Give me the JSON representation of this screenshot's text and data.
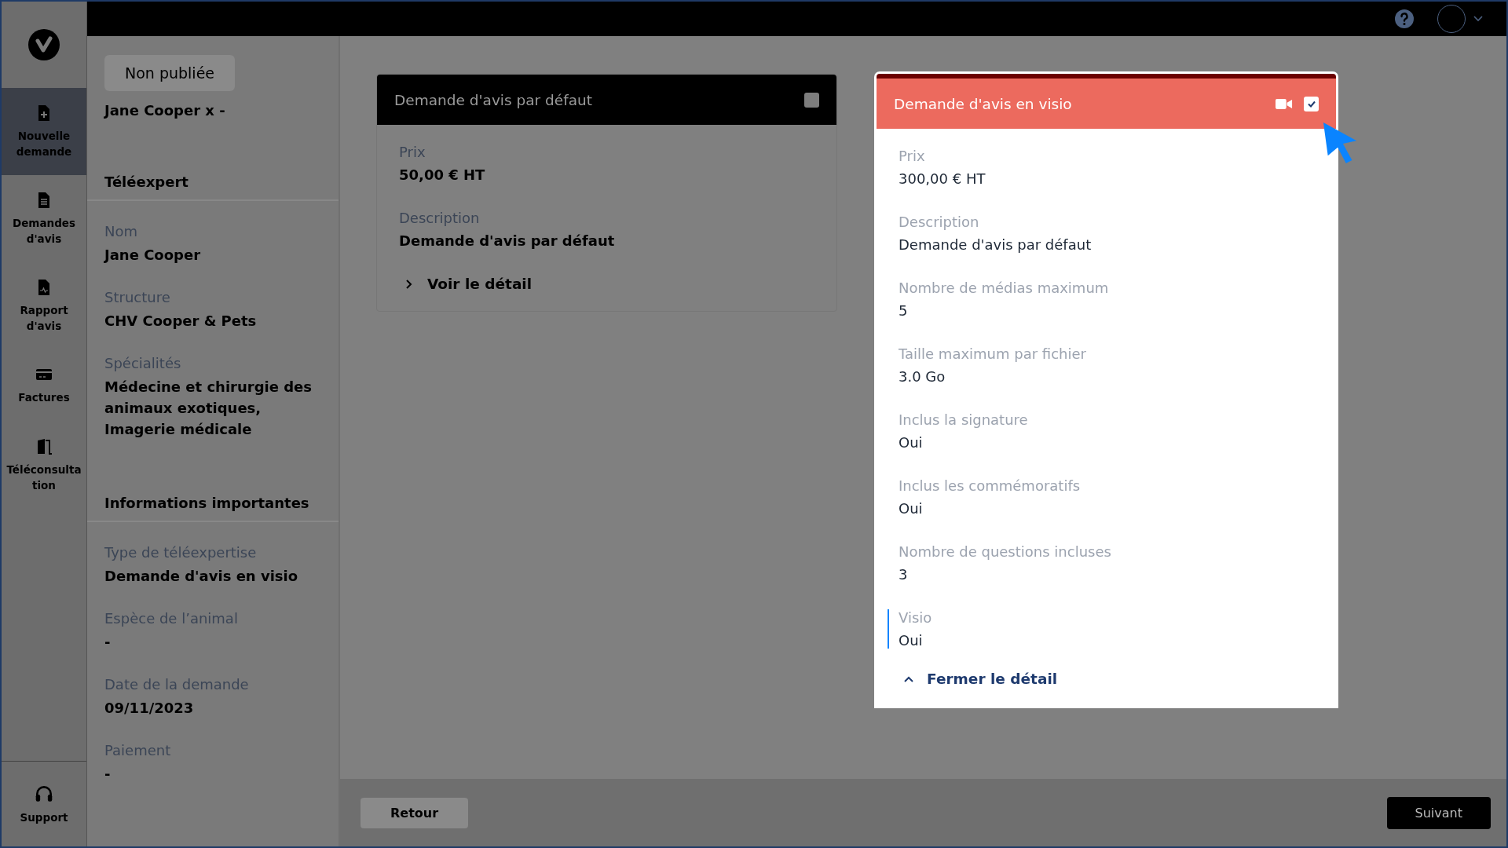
{
  "sidebar": {
    "items": [
      {
        "label": "Nouvelle demande",
        "selected": true
      },
      {
        "label": "Demandes d'avis",
        "selected": false
      },
      {
        "label": "Rapport d'avis",
        "selected": false
      },
      {
        "label": "Factures",
        "selected": false
      },
      {
        "label": "Téléconsultation",
        "selected": false
      }
    ],
    "footer_item": {
      "label": "Support",
      "selected": false
    }
  },
  "summary": {
    "status": "Non publiée",
    "title": "Jane Cooper x -",
    "sections": [
      {
        "title": "Téléexpert",
        "fields": [
          {
            "label": "Nom",
            "value": "Jane Cooper"
          },
          {
            "label": "Structure",
            "value": "CHV Cooper & Pets"
          },
          {
            "label": "Spécialités",
            "value": "Médecine et chirurgie des animaux exotiques, Imagerie médicale"
          }
        ]
      },
      {
        "title": "Informations importantes",
        "fields": [
          {
            "label": "Type de téléexpertise",
            "value": "Demande d'avis en visio"
          },
          {
            "label": "Espèce de l’animal",
            "value": "-"
          },
          {
            "label": "Date de la demande",
            "value": "09/11/2023"
          },
          {
            "label": "Paiement",
            "value": "-"
          }
        ]
      }
    ]
  },
  "offers": [
    {
      "kind": "standard",
      "title": "Demande d'avis par défaut",
      "selected": false,
      "expanded": false,
      "toggle_label": "Voir le détail",
      "fields": [
        {
          "label": "Prix",
          "value": "50,00 € HT",
          "focused": false
        },
        {
          "label": "Description",
          "value": "Demande d'avis par défaut",
          "focused": false
        }
      ]
    },
    {
      "kind": "visio",
      "title": "Demande d'avis en visio",
      "selected": true,
      "expanded": true,
      "toggle_label": "Fermer le détail",
      "fields": [
        {
          "label": "Prix",
          "value": "300,00 € HT",
          "focused": false
        },
        {
          "label": "Description",
          "value": "Demande d'avis par défaut",
          "focused": false
        },
        {
          "label": "Nombre de médias maximum",
          "value": "5",
          "focused": false
        },
        {
          "label": "Taille maximum par fichier",
          "value": "3.0 Go",
          "focused": false
        },
        {
          "label": "Inclus la signature",
          "value": "Oui",
          "focused": false
        },
        {
          "label": "Inclus les commémoratifs",
          "value": "Oui",
          "focused": false
        },
        {
          "label": "Nombre de questions incluses",
          "value": "3",
          "focused": false
        },
        {
          "label": "Visio",
          "value": "Oui",
          "focused": true
        }
      ]
    }
  ],
  "footer": {
    "back_button": "Retour",
    "next_button": "Suivant"
  }
}
